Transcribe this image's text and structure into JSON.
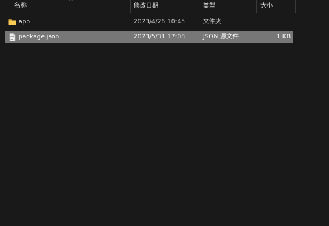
{
  "columns": {
    "name": "名称",
    "modified": "修改日期",
    "type": "类型",
    "size": "大小"
  },
  "sort_indicator": "^",
  "files": [
    {
      "name": "app",
      "modified": "2023/4/26 10:45",
      "type": "文件夹",
      "size": "",
      "icon": "folder-icon",
      "selected": false
    },
    {
      "name": "package.json",
      "modified": "2023/5/31 17:08",
      "type": "JSON 源文件",
      "size": "1 KB",
      "icon": "json-file-icon",
      "selected": true
    }
  ],
  "colors": {
    "background": "#191919",
    "selection": "#777777",
    "folder": "#f5c542"
  }
}
